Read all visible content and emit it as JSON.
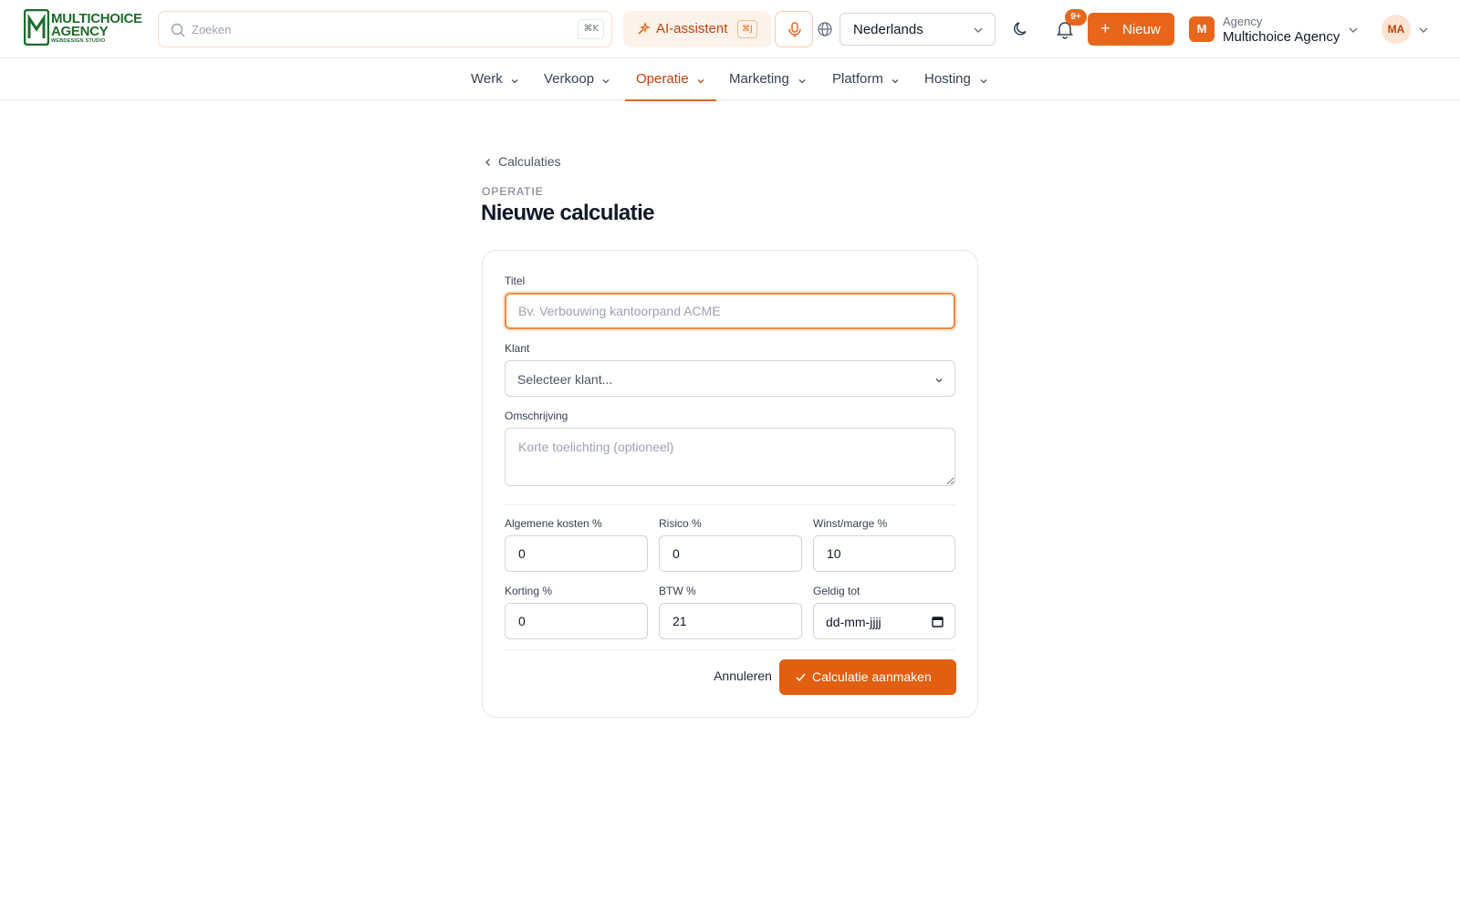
{
  "logo": {
    "line1": "MULTICHOICE",
    "line2": "AGENCY",
    "line3": "WEBDESIGN STUDIO"
  },
  "search": {
    "placeholder": "Zoeken",
    "shortcut": "⌘K"
  },
  "ai": {
    "label": "AI-assistent",
    "shortcut": "⌘J"
  },
  "language": {
    "selected": "Nederlands"
  },
  "notifications": {
    "badge": "9+"
  },
  "new_button": {
    "label": "Nieuw"
  },
  "org": {
    "initial": "M",
    "kind": "Agency",
    "name": "Multichoice Agency"
  },
  "user": {
    "initials": "MA"
  },
  "nav": {
    "items": [
      {
        "label": "Werk"
      },
      {
        "label": "Verkoop"
      },
      {
        "label": "Operatie"
      },
      {
        "label": "Marketing"
      },
      {
        "label": "Platform"
      },
      {
        "label": "Hosting"
      }
    ],
    "active": "Operatie"
  },
  "page": {
    "back_label": "Calculaties",
    "eyebrow": "OPERATIE",
    "title": "Nieuwe calculatie"
  },
  "form": {
    "titel": {
      "label": "Titel",
      "placeholder": "Bv. Verbouwing kantoorpand ACME",
      "value": ""
    },
    "klant": {
      "label": "Klant",
      "placeholder": "Selecteer klant..."
    },
    "omschrijving": {
      "label": "Omschrijving",
      "placeholder": "Korte toelichting (optioneel)"
    },
    "algemene_kosten": {
      "label": "Algemene kosten %",
      "value": "0"
    },
    "risico": {
      "label": "Risico %",
      "value": "0"
    },
    "winst": {
      "label": "Winst/marge %",
      "value": "10"
    },
    "korting": {
      "label": "Korting %",
      "value": "0"
    },
    "btw": {
      "label": "BTW %",
      "value": "21"
    },
    "geldig_tot": {
      "label": "Geldig tot",
      "placeholder": "dd-mm-jjjj"
    },
    "cancel_label": "Annuleren",
    "submit_label": "Calculatie aanmaken"
  },
  "colors": {
    "accent": "#e8661c",
    "brand_green": "#1f6b2e"
  }
}
